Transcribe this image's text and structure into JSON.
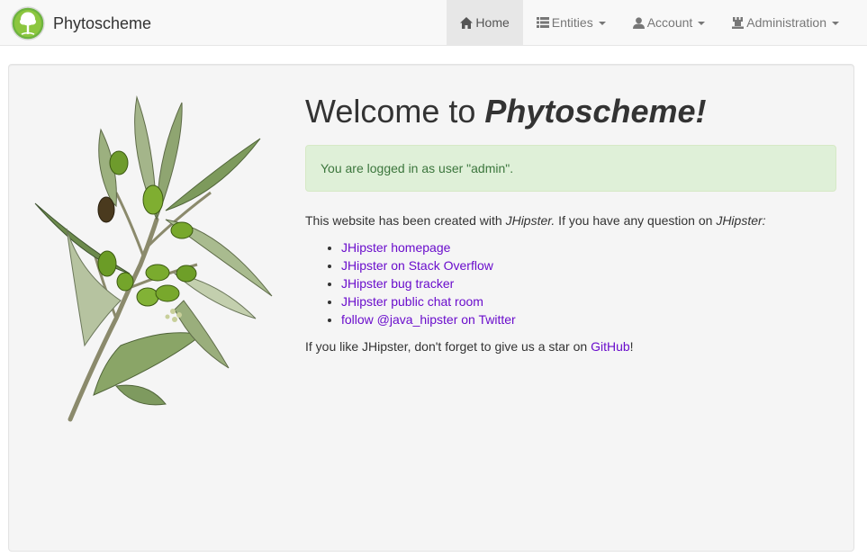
{
  "navbar": {
    "brand": "Phytoscheme",
    "items": [
      {
        "label": "Home",
        "icon": "home-icon",
        "active": true
      },
      {
        "label": "Entities",
        "icon": "list-icon",
        "dropdown": true
      },
      {
        "label": "Account",
        "icon": "user-icon",
        "dropdown": true
      },
      {
        "label": "Administration",
        "icon": "tower-icon",
        "dropdown": true
      }
    ]
  },
  "main": {
    "title_prefix": "Welcome to ",
    "title_app": "Phytoscheme!",
    "alert": "You are logged in as user \"admin\".",
    "intro_text": "This website has been created with ",
    "intro_jhipster": "JHipster.",
    "intro_question": " If you have any question on ",
    "intro_jhipster_2": "JHipster:",
    "links": [
      "JHipster homepage",
      "JHipster on Stack Overflow",
      "JHipster bug tracker",
      "JHipster public chat room",
      "follow @java_hipster on Twitter"
    ],
    "outro_text": "If you like JHipster, don't forget to give us a star on ",
    "outro_link": "GitHub",
    "outro_end": "!"
  },
  "colors": {
    "link": "#6a0dcc",
    "alert_bg": "#dff0d8",
    "alert_text": "#3c763d",
    "navbar_bg": "#f8f8f8",
    "logo_green": "#5cb85c"
  }
}
